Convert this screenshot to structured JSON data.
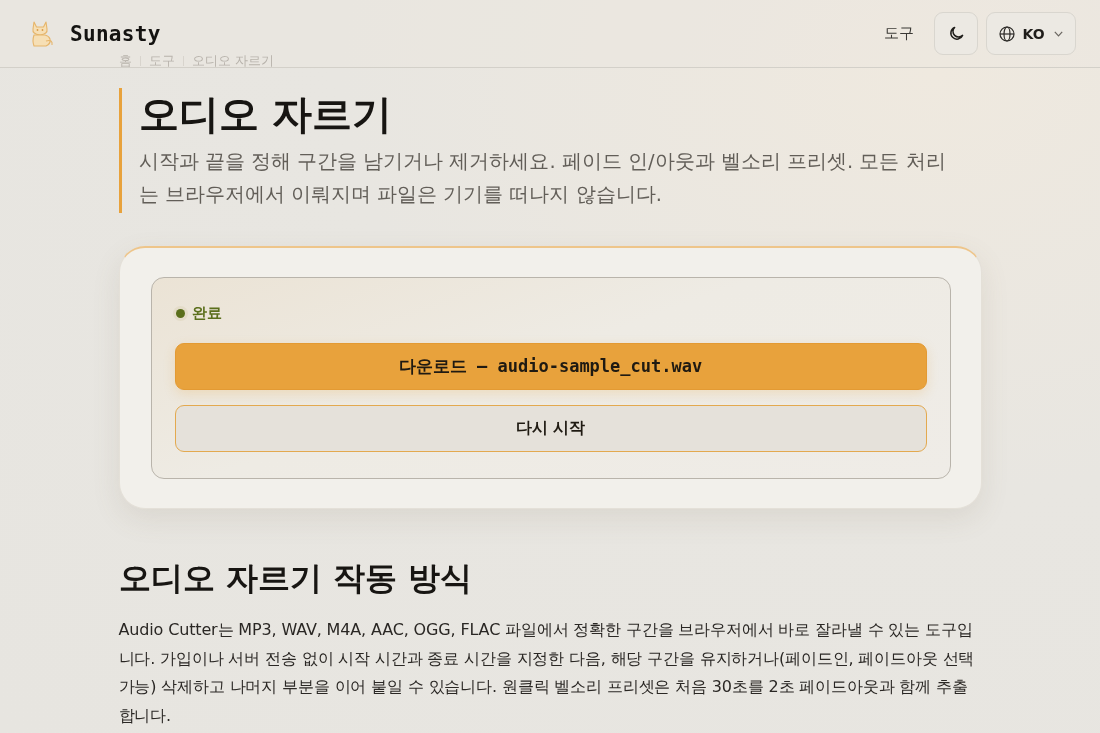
{
  "header": {
    "brand": "Sunasty",
    "nav_link": "도구",
    "language": "KO"
  },
  "breadcrumb": [
    "홈",
    "도구",
    "오디오 자르기"
  ],
  "page": {
    "title": "오디오 자르기",
    "description": "시작과 끝을 정해 구간을 남기거나 제거하세요. 페이드 인/아웃과 벨소리 프리셋. 모든 처리는 브라우저에서 이뤄지며 파일은 기기를 떠나지 않습니다."
  },
  "result_card": {
    "status": {
      "kind": "success",
      "label": "완료"
    },
    "buttons": [
      {
        "kind": "primary",
        "label": "다운로드 — audio-sample_cut.wav"
      },
      {
        "kind": "secondary",
        "label": "다시 시작"
      }
    ]
  },
  "how_it_works": {
    "heading": "오디오 자르기 작동 방식",
    "paragraph": "Audio Cutter는 MP3, WAV, M4A, AAC, OGG, FLAC 파일에서 정확한 구간을 브라우저에서 바로 잘라낼 수 있는 도구입니다. 가입이나 서버 전송 없이 시작 시간과 종료 시간을 지정한 다음, 해당 구간을 유지하거나(페이드인, 페이드아웃 선택 가능) 삭제하고 나머지 부분을 이어 붙일 수 있습니다. 원클릭 벨소리 프리셋은 처음 30초를 2초 페이드아웃과 함께 추출합니다."
  }
}
